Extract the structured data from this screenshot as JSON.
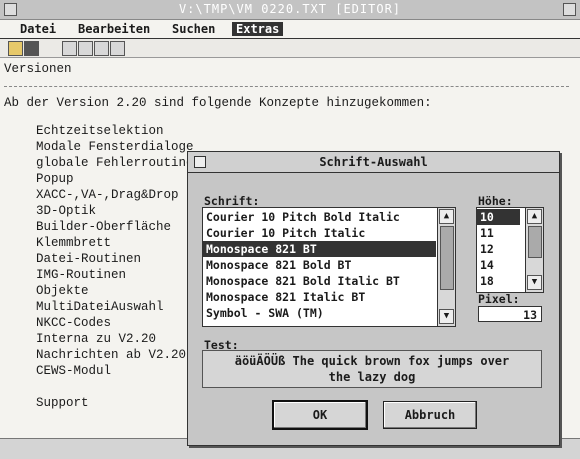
{
  "window": {
    "title": "V:\\TMP\\VM 0220.TXT [EDITOR]"
  },
  "menubar": {
    "items": [
      "Datei",
      "Bearbeiten",
      "Suchen",
      "Extras"
    ]
  },
  "toolbar": {
    "icons": [
      "folder-open-icon",
      "save-icon",
      "cut-icon",
      "copy-icon",
      "paste-icon",
      "print-icon"
    ]
  },
  "editor": {
    "heading": "Versionen",
    "intro": "Ab der Version 2.20 sind folgende Konzepte hinzugekommen:",
    "lines": [
      "Echtzeitselektion",
      "Modale Fensterdialoge",
      "globale Fehlerroutinen",
      "Popup",
      "XACC-,VA-,Drag&Drop",
      "3D-Optik",
      "Builder-Oberfläche",
      "Klemmbrett",
      "Datei-Routinen",
      "IMG-Routinen",
      "Objekte",
      "MultiDateiAuswahl",
      "NKCC-Codes",
      "Interna zu V2.20",
      "Nachrichten ab V2.20",
      "CEWS-Modul",
      "",
      "Support"
    ]
  },
  "dialog": {
    "title": "Schrift-Auswahl",
    "font_label": "Schrift:",
    "fonts": [
      "Courier 10 Pitch Bold Italic",
      "Courier 10 Pitch Italic",
      "Monospace 821 BT",
      "Monospace 821 Bold BT",
      "Monospace 821 Bold Italic BT",
      "Monospace 821 Italic BT",
      "Symbol - SWA (TM)"
    ],
    "selected_font_index": 2,
    "height_label": "Höhe:",
    "heights": [
      "10",
      "11",
      "12",
      "14",
      "18"
    ],
    "selected_height_index": 0,
    "pixel_label": "Pixel:",
    "pixel_value": "13",
    "test_label": "Test:",
    "test_text_line1": "äöüÄÖÜß The quick brown fox jumps over",
    "test_text_line2": "the lazy dog",
    "ok_label": "OK",
    "cancel_label": "Abbruch"
  }
}
